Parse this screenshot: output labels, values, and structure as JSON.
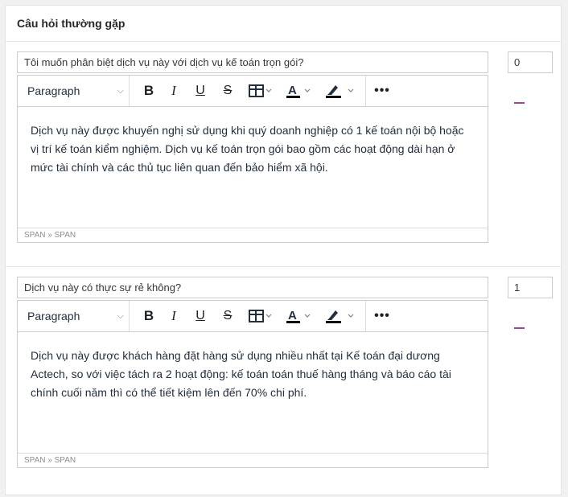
{
  "section": {
    "title": "Câu hỏi thường gặp"
  },
  "toolbar": {
    "format_label": "Paragraph",
    "bold_label": "B",
    "italic_label": "I",
    "underline_label": "U",
    "strike_label": "S",
    "icons": [
      "chevron-down-icon",
      "table-icon",
      "font-color-icon",
      "highlight-icon",
      "more-icon"
    ]
  },
  "faqs": [
    {
      "question": "Tôi muốn phân biệt dịch vụ này với dịch vụ kế toán trọn gói?",
      "answer": "Dịch vụ này được khuyến nghị sử dụng khi quý doanh nghiệp có 1 kế toán nội bộ hoặc vị trí kế toán kiểm nghiệm. Dịch vụ kế toán trọn gói bao gồm các hoạt động dài hạn ở mức tài chính và các thủ tục liên quan đến bảo hiểm xã hội.",
      "path": "SPAN » SPAN",
      "order": "0"
    },
    {
      "question": "Dịch vụ này có thực sự rẻ không?",
      "answer": "Dịch vụ này được khách hàng đặt hàng sử dụng nhiều nhất tại Kế toán đại dương Actech, so với việc tách ra 2 hoạt động: kế toán toán thuế hàng tháng và báo cáo tài chính cuối năm thì có thể tiết kiệm lên đến 70% chi phí.",
      "path": "SPAN » SPAN",
      "order": "1"
    }
  ],
  "colors": {
    "accent": "#a0439c",
    "border": "#cccccc"
  }
}
